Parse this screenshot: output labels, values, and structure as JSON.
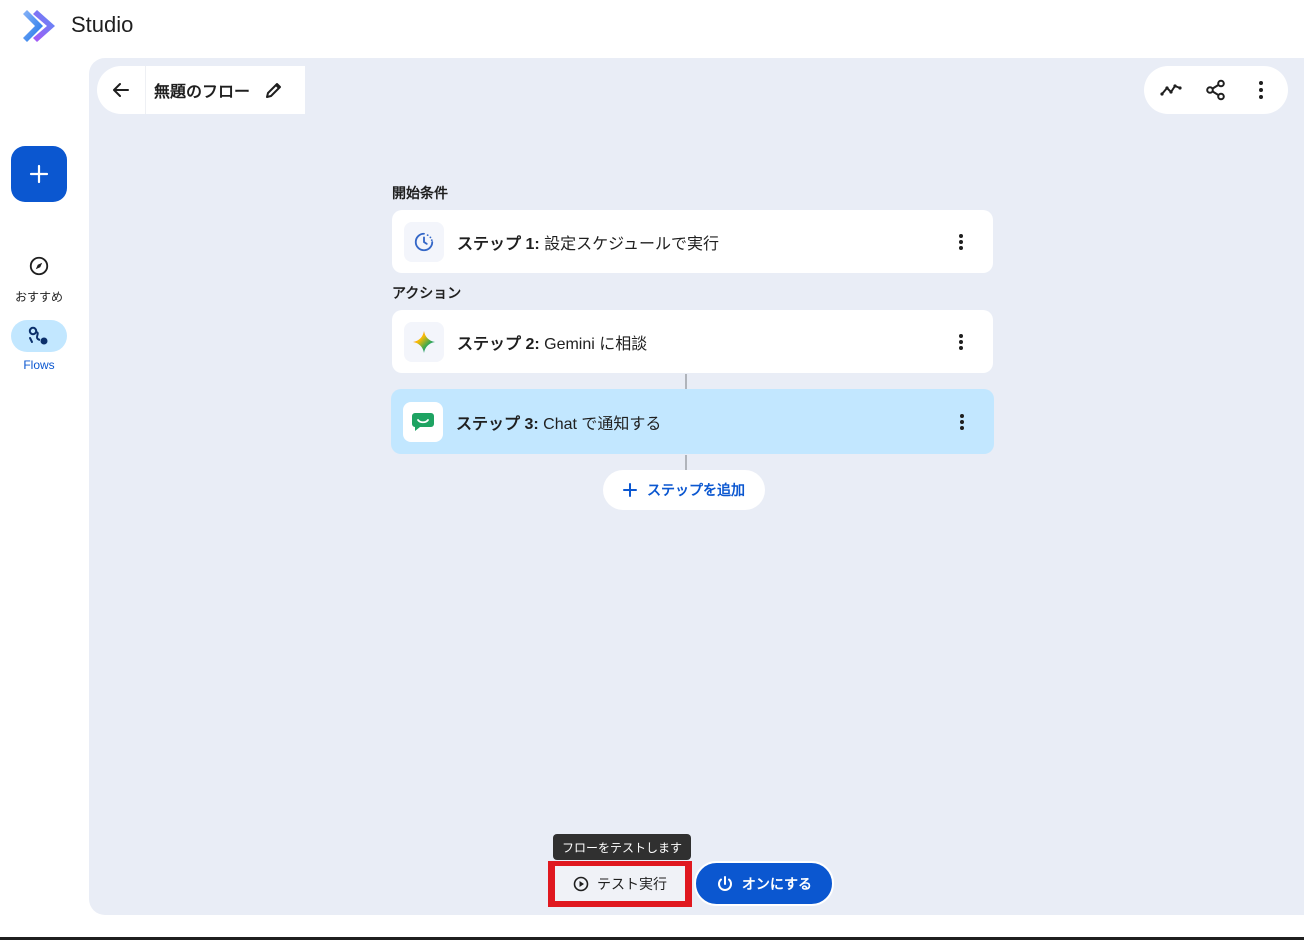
{
  "app": {
    "title": "Studio"
  },
  "rail": {
    "create_icon": "plus-icon",
    "items": [
      {
        "label": "おすすめ",
        "icon": "compass-icon",
        "active": false
      },
      {
        "label": "Flows",
        "icon": "flows-icon",
        "active": true
      }
    ]
  },
  "flow": {
    "name": "無題のフロー",
    "start_section": "開始条件",
    "actions_section": "アクション",
    "steps": [
      {
        "prefix": "ステップ 1:",
        "text": " 設定スケジュールで実行",
        "icon": "schedule-icon"
      },
      {
        "prefix": "ステップ 2:",
        "text": " Gemini に相談",
        "icon": "gemini-icon"
      },
      {
        "prefix": "ステップ 3:",
        "text": " Chat で通知する",
        "icon": "chat-icon",
        "selected": true
      }
    ],
    "add_step_label": "ステップを追加"
  },
  "toolbar": {
    "icons": [
      "activity-icon",
      "share-icon",
      "more-vert-icon"
    ]
  },
  "bottom": {
    "tooltip": "フローをテストします",
    "test_label": "テスト実行",
    "turn_on_label": "オンにする"
  },
  "colors": {
    "accent": "#0b57d0",
    "canvas": "#e9edf6",
    "selected_card": "#c2e7ff",
    "highlight": "#e0181f"
  }
}
